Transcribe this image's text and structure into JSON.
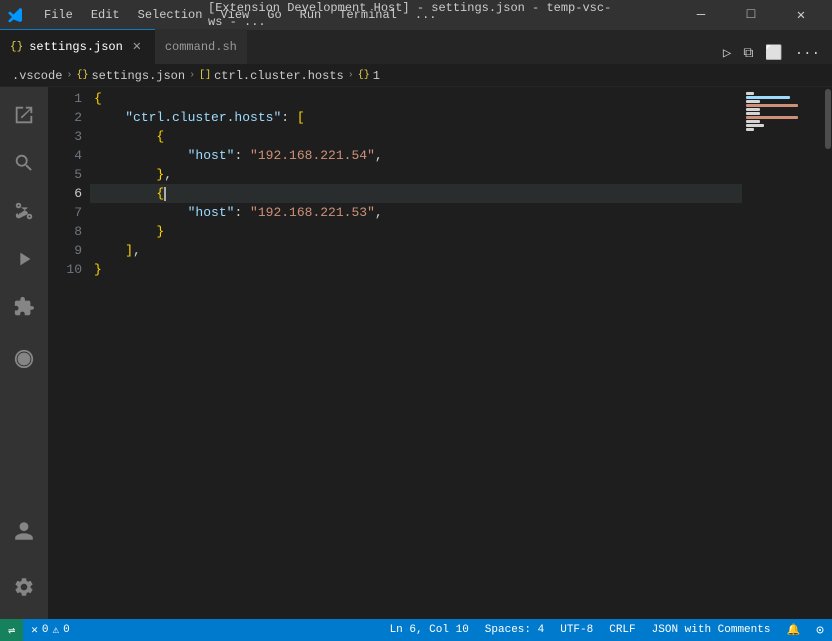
{
  "titleBar": {
    "title": "[Extension Development Host] - settings.json - temp-vsc-ws - ...",
    "minimize": "—",
    "maximize": "□",
    "close": "✕"
  },
  "menu": {
    "items": [
      "File",
      "Edit",
      "Selection",
      "View",
      "Go",
      "Run",
      "Terminal",
      "..."
    ]
  },
  "tabs": [
    {
      "id": "settings",
      "label": "settings.json",
      "icon": "{}",
      "active": true,
      "modified": false
    },
    {
      "id": "command",
      "label": "command.sh",
      "active": false,
      "modified": false
    }
  ],
  "tabRightIcons": [
    "▷",
    "⧉",
    "⬜",
    "..."
  ],
  "breadcrumb": {
    "items": [
      {
        "icon": ".vscode",
        "label": ".vscode"
      },
      {
        "icon": "{}",
        "label": "settings.json"
      },
      {
        "icon": "[]",
        "label": "ctrl.cluster.hosts"
      },
      {
        "icon": "{}",
        "label": "1"
      }
    ]
  },
  "activityBar": {
    "icons": [
      {
        "id": "explorer",
        "symbol": "⎘",
        "active": false
      },
      {
        "id": "search",
        "symbol": "🔍",
        "active": false
      },
      {
        "id": "source-control",
        "symbol": "⑂",
        "active": false
      },
      {
        "id": "run",
        "symbol": "▷",
        "active": false
      },
      {
        "id": "extensions",
        "symbol": "⊞",
        "active": false
      },
      {
        "id": "remote",
        "symbol": "⊙",
        "active": false
      }
    ],
    "bottomIcons": [
      {
        "id": "accounts",
        "symbol": "⊕",
        "active": false
      },
      {
        "id": "settings",
        "symbol": "⚙",
        "active": false
      }
    ]
  },
  "editor": {
    "lines": [
      {
        "num": "1",
        "content": "{",
        "type": "brace-open"
      },
      {
        "num": "2",
        "content": "    \"ctrl.cluster.hosts\": [",
        "type": "key-bracket"
      },
      {
        "num": "3",
        "content": "        {",
        "type": "brace-open-indent"
      },
      {
        "num": "4",
        "content": "            \"host\": \"192.168.221.54\",",
        "type": "key-value"
      },
      {
        "num": "5",
        "content": "        },",
        "type": "brace-close-comma"
      },
      {
        "num": "6",
        "content": "        {",
        "type": "brace-open-indent-cursor",
        "active": true
      },
      {
        "num": "7",
        "content": "            \"host\": \"192.168.221.53\",",
        "type": "key-value"
      },
      {
        "num": "8",
        "content": "        }",
        "type": "brace-close-indent"
      },
      {
        "num": "9",
        "content": "    ],",
        "type": "bracket-close"
      },
      {
        "num": "10",
        "content": "}",
        "type": "brace-close"
      }
    ],
    "activeLine": 6,
    "cursorCol": 10
  },
  "statusBar": {
    "errorCount": "0",
    "warningCount": "0",
    "line": "Ln 6",
    "col": "Col 10",
    "spaces": "Spaces: 4",
    "encoding": "UTF-8",
    "lineEnding": "CRLF",
    "language": "JSON with Comments",
    "feedback": "🔔",
    "remote": "⊙"
  }
}
